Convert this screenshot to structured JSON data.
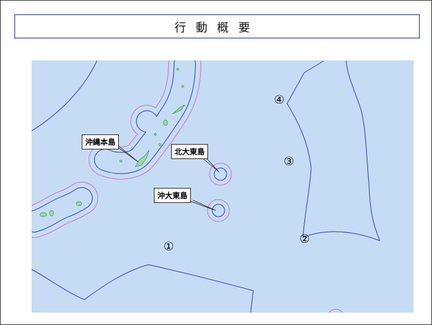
{
  "title": "行動概要",
  "colors": {
    "sea": "#c6dcf4",
    "contour_blue": "#3344bb",
    "contour_pink": "#d070c0",
    "land": "#9ed9a8"
  },
  "labels": {
    "okinawa": "沖縄本島",
    "kitadaito": "北大東島",
    "okidaito": "沖大東島"
  },
  "markers": {
    "m1": "①",
    "m2": "②",
    "m3": "③",
    "m4": "④"
  }
}
